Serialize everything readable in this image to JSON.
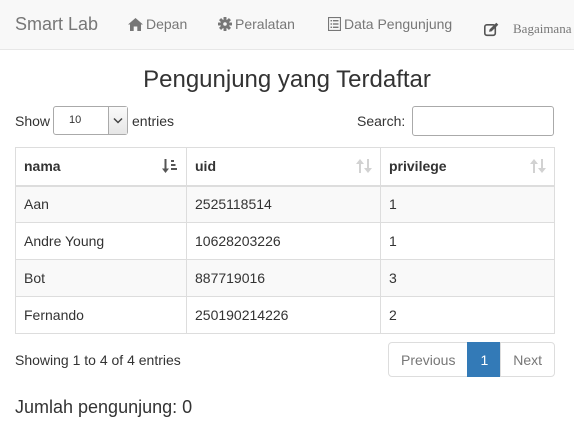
{
  "navbar": {
    "brand": "Smart Lab",
    "items": [
      {
        "label": "Depan",
        "icon": "home-icon"
      },
      {
        "label": "Peralatan",
        "icon": "gear-icon"
      },
      {
        "label": "Data Pengunjung",
        "icon": "list-icon"
      },
      {
        "label": "Bagaimana",
        "icon": "edit-icon"
      }
    ]
  },
  "page": {
    "title": "Pengunjung yang Terdaftar"
  },
  "controls": {
    "show_label": "Show",
    "entries_label": "entries",
    "length_value": "10",
    "search_label": "Search:",
    "search_value": ""
  },
  "table": {
    "columns": [
      "nama",
      "uid",
      "privilege"
    ],
    "sorted_column": "nama",
    "rows": [
      [
        "Aan",
        "2525118514",
        "1"
      ],
      [
        "Andre Young",
        "10628203226",
        "1"
      ],
      [
        "Bot",
        "887719016",
        "3"
      ],
      [
        "Fernando",
        "250190214226",
        "2"
      ]
    ]
  },
  "footer": {
    "info": "Showing 1 to 4 of 4 entries",
    "previous": "Previous",
    "current_page": "1",
    "next": "Next"
  },
  "summary": {
    "visitor_count": "Jumlah pengunjung: 0"
  },
  "colors": {
    "navbar_bg": "#f8f8f8",
    "accent": "#337ab7"
  }
}
